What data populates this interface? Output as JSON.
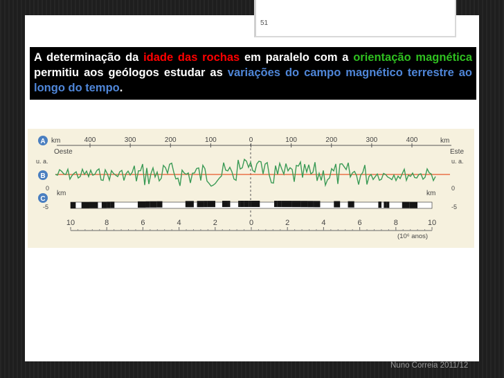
{
  "slide": {
    "number": "51",
    "text": {
      "t1": "A determinação da ",
      "h1": "idade das rochas",
      "t2": " em paralelo com a ",
      "h2": "orientação magnética",
      "t3": " permitiu aos geólogos estudar as ",
      "h3a": "variações",
      "h3b": "do",
      "h3c": "campo magnético terrestre ao longo do tempo",
      "t4": "."
    },
    "footer": "Nuno Correia 2011/12"
  },
  "figure": {
    "label_a": "A",
    "label_b": "B",
    "label_c": "C",
    "km_left": "km",
    "km_right": "km",
    "oeste": "Oeste",
    "este": "Este",
    "ua_left": "u. a.",
    "ua_right": "u. a.",
    "zero_left": "0",
    "zero_right": "0",
    "km_c_left": "km",
    "km_c_right": "km",
    "minus5_left": "-5",
    "minus5_right": "-5",
    "top_ticks": [
      "400",
      "300",
      "200",
      "100",
      "0",
      "100",
      "200",
      "300",
      "400"
    ],
    "bottom_ticks": [
      "10",
      "8",
      "6",
      "4",
      "2",
      "0",
      "2",
      "4",
      "6",
      "8",
      "10"
    ],
    "age_unit": "(10⁶ anos)",
    "colors": {
      "anomaly": "#3a9a55",
      "baseline": "#e8582a"
    }
  }
}
